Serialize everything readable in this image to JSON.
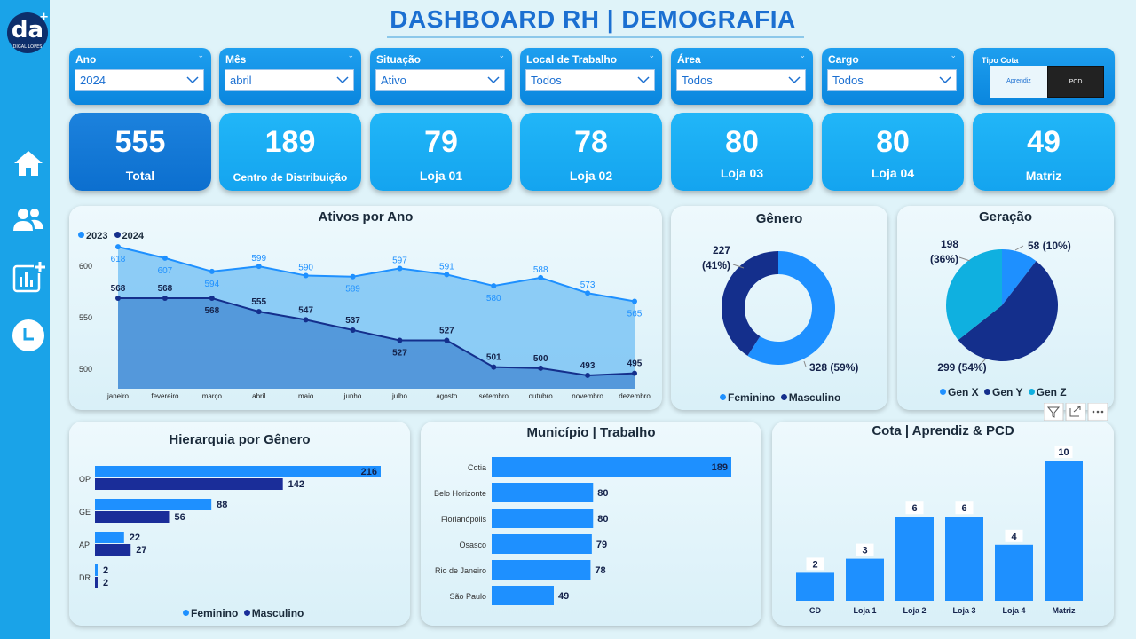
{
  "header": {
    "title": "DASHBOARD RH | DEMOGRAFIA"
  },
  "logo": {
    "text": "da",
    "sub": "DIGAL LOPES"
  },
  "sidebar": {
    "icons": [
      "home-icon",
      "users-icon",
      "report-add-icon",
      "clock-icon"
    ]
  },
  "filters": [
    {
      "label": "Ano",
      "value": "2024"
    },
    {
      "label": "Mês",
      "value": "abril"
    },
    {
      "label": "Situação",
      "value": "Ativo"
    },
    {
      "label": "Local de Trabalho",
      "value": "Todos"
    },
    {
      "label": "Área",
      "value": "Todos"
    },
    {
      "label": "Cargo",
      "value": "Todos"
    }
  ],
  "cota_filter": {
    "label": "Tipo Cota",
    "options": [
      "Aprendiz",
      "PCD"
    ],
    "selected": "PCD"
  },
  "kpis": [
    {
      "value": "555",
      "label": "Total"
    },
    {
      "value": "189",
      "label": "Centro de Distribuição"
    },
    {
      "value": "79",
      "label": "Loja 01"
    },
    {
      "value": "78",
      "label": "Loja 02"
    },
    {
      "value": "80",
      "label": "Loja 03"
    },
    {
      "value": "80",
      "label": "Loja 04"
    },
    {
      "value": "49",
      "label": "Matriz"
    }
  ],
  "colors": {
    "light_blue": "#1e90ff",
    "dark_blue": "#142f8c",
    "sky": "#0fb0e0",
    "bar_light": "#1e90ff",
    "bar_dark": "#1a2d99"
  },
  "chart_data": [
    {
      "type": "area",
      "title": "Ativos por Ano",
      "categories": [
        "janeiro",
        "fevereiro",
        "março",
        "abril",
        "maio",
        "junho",
        "julho",
        "agosto",
        "setembro",
        "outubro",
        "novembro",
        "dezembro"
      ],
      "series": [
        {
          "name": "2023",
          "values": [
            618,
            607,
            594,
            599,
            590,
            589,
            597,
            591,
            580,
            588,
            573,
            565
          ]
        },
        {
          "name": "2024",
          "values": [
            568,
            568,
            568,
            555,
            547,
            537,
            527,
            527,
            501,
            500,
            493,
            495
          ]
        }
      ],
      "yticks": [
        500,
        550,
        600
      ],
      "ylim": [
        480,
        625
      ],
      "legend": "top-left"
    },
    {
      "type": "pie",
      "title": "Gênero",
      "donut": true,
      "slices": [
        {
          "name": "Feminino",
          "value": 328,
          "label": "328 (59%)"
        },
        {
          "name": "Masculino",
          "value": 227,
          "label": "227 (41%)"
        }
      ],
      "legend": "bottom"
    },
    {
      "type": "pie",
      "title": "Geração",
      "slices": [
        {
          "name": "Gen X",
          "value": 58,
          "label": "58 (10%)"
        },
        {
          "name": "Gen Y",
          "value": 299,
          "label": "299 (54%)"
        },
        {
          "name": "Gen Z",
          "value": 198,
          "label": "198 (36%)"
        }
      ],
      "legend": "bottom"
    },
    {
      "type": "bar",
      "orientation": "horizontal",
      "title": "Hierarquia por Gênero",
      "categories": [
        "OP",
        "GE",
        "AP",
        "DR"
      ],
      "series": [
        {
          "name": "Feminino",
          "values": [
            216,
            88,
            22,
            2
          ]
        },
        {
          "name": "Masculino",
          "values": [
            142,
            56,
            27,
            2
          ]
        }
      ],
      "legend": "bottom"
    },
    {
      "type": "bar",
      "orientation": "horizontal",
      "title": "Município | Trabalho",
      "categories": [
        "Cotia",
        "Belo Horizonte",
        "Florianópolis",
        "Osasco",
        "Rio de Janeiro",
        "São Paulo"
      ],
      "values": [
        189,
        80,
        80,
        79,
        78,
        49
      ]
    },
    {
      "type": "bar",
      "title": "Cota | Aprendiz & PCD",
      "categories": [
        "CD",
        "Loja 1",
        "Loja 2",
        "Loja 3",
        "Loja 4",
        "Matriz"
      ],
      "values": [
        2,
        3,
        6,
        6,
        4,
        10
      ]
    }
  ]
}
